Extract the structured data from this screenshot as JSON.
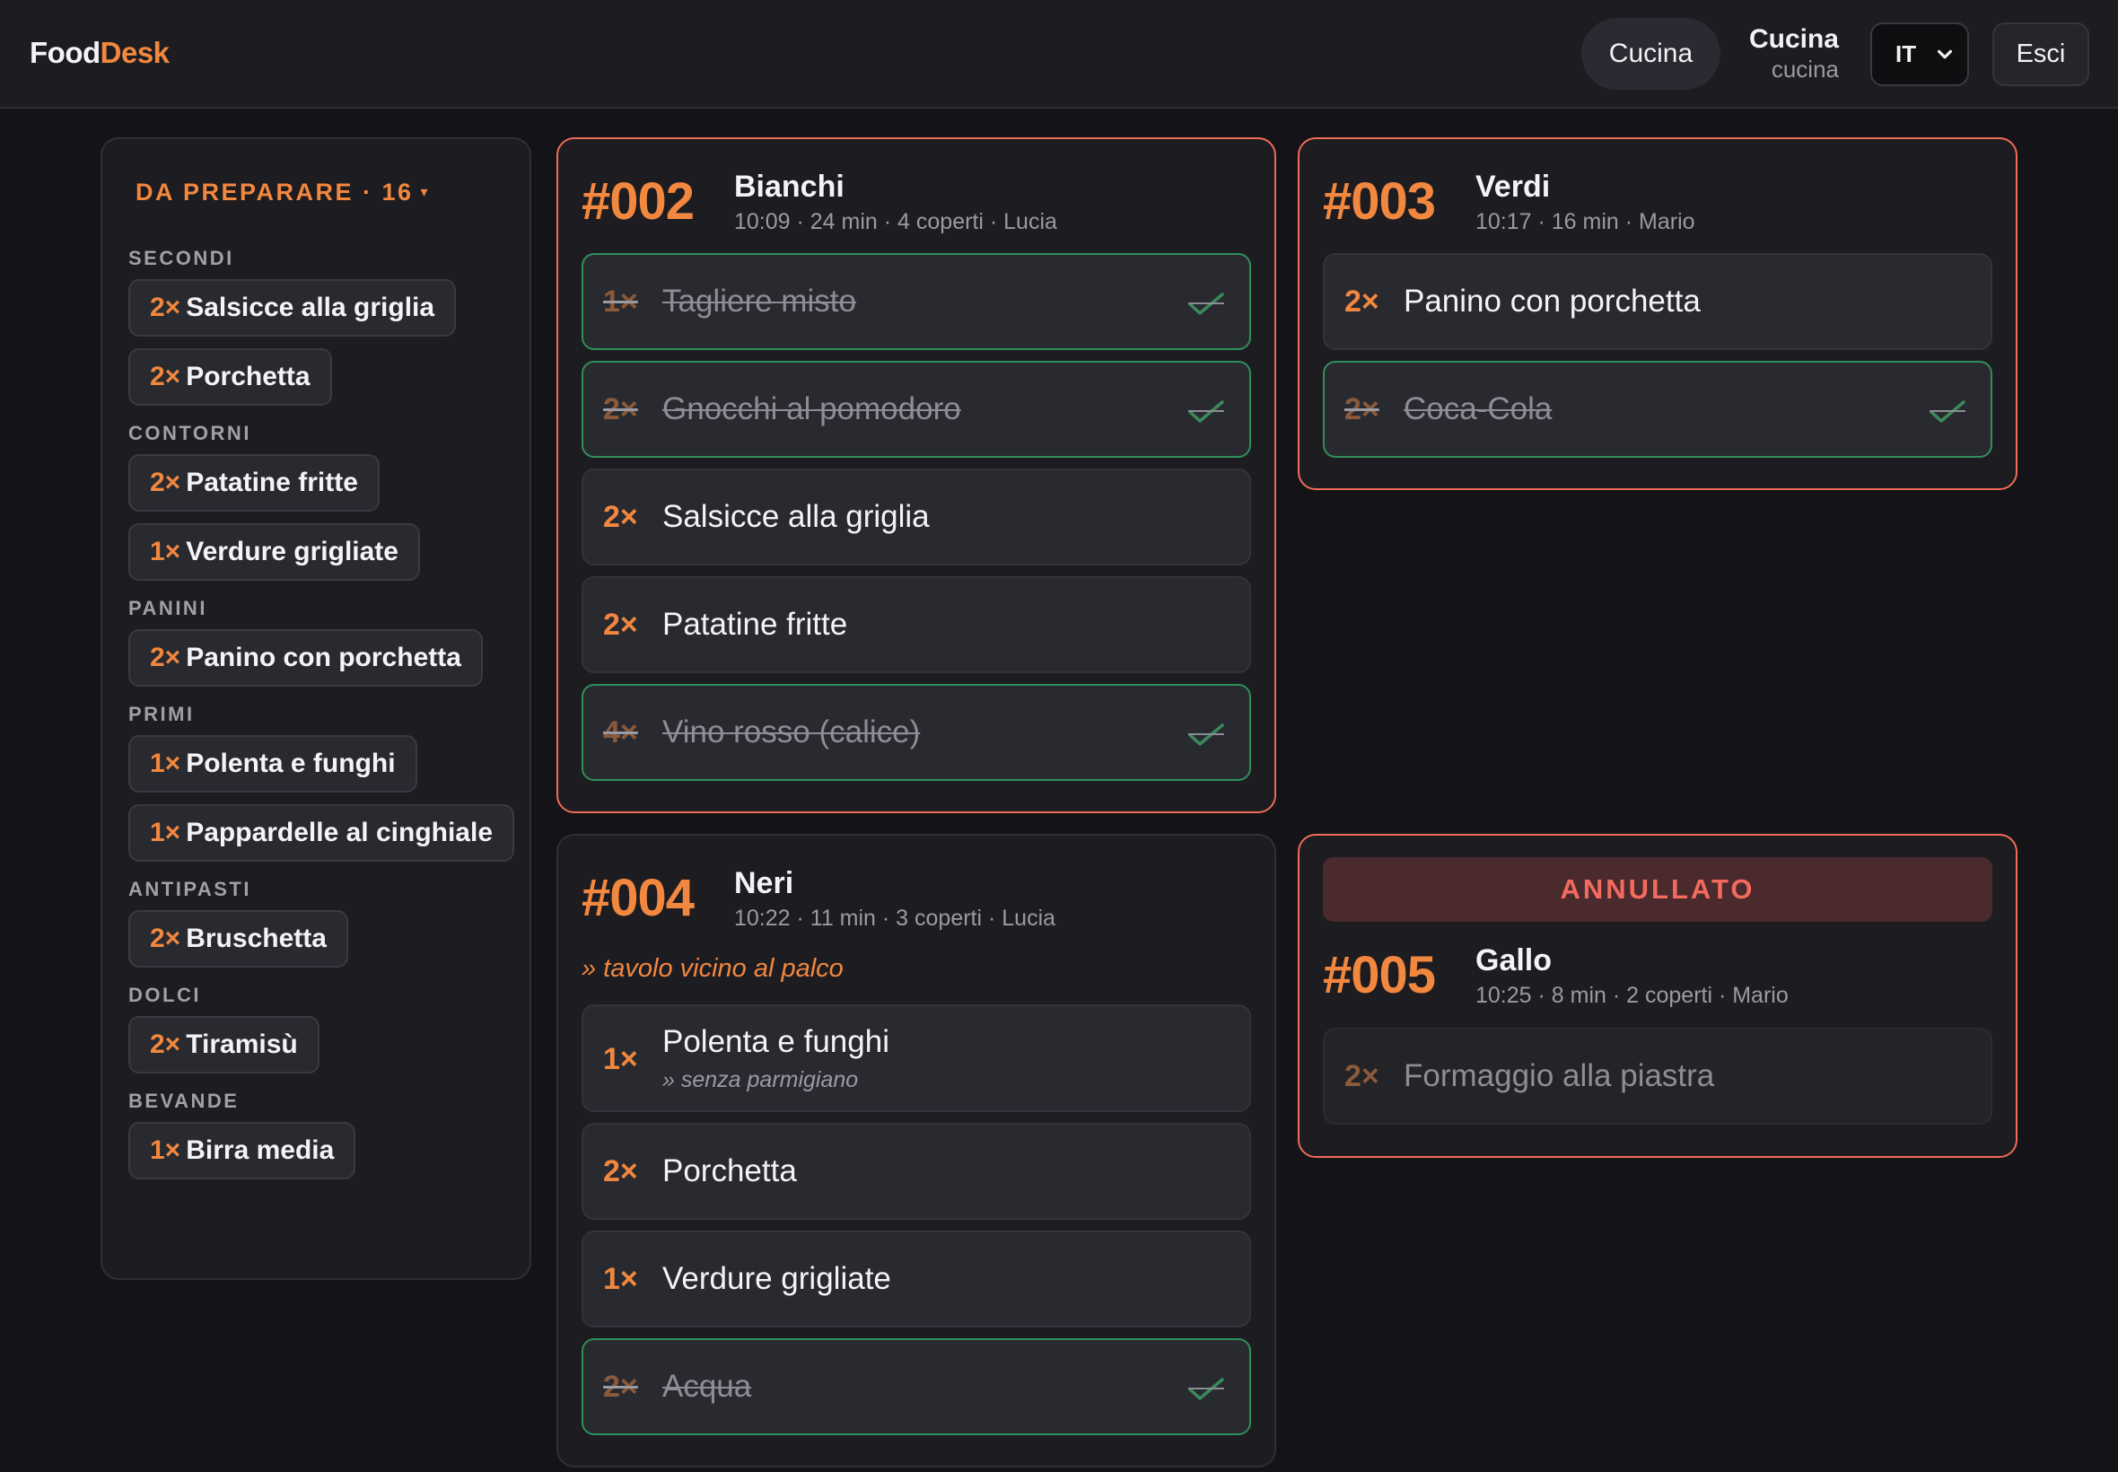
{
  "header": {
    "logo_part1": "Food",
    "logo_part2": "Desk",
    "role_button": "Cucina",
    "user_name": "Cucina",
    "user_role": "cucina",
    "language": "IT",
    "exit_button": "Esci"
  },
  "summary": {
    "title": "DA PREPARARE · 16",
    "caret": "▾",
    "categories": [
      {
        "name": "SECONDI",
        "items": [
          {
            "qty": "2×",
            "name": "Salsicce alla griglia"
          },
          {
            "qty": "2×",
            "name": "Porchetta"
          }
        ]
      },
      {
        "name": "CONTORNI",
        "items": [
          {
            "qty": "2×",
            "name": "Patatine fritte"
          },
          {
            "qty": "1×",
            "name": "Verdure grigliate"
          }
        ]
      },
      {
        "name": "PANINI",
        "items": [
          {
            "qty": "2×",
            "name": "Panino con porchetta"
          }
        ]
      },
      {
        "name": "PRIMI",
        "items": [
          {
            "qty": "1×",
            "name": "Polenta e funghi"
          },
          {
            "qty": "1×",
            "name": "Pappardelle al cinghiale"
          }
        ]
      },
      {
        "name": "ANTIPASTI",
        "items": [
          {
            "qty": "2×",
            "name": "Bruschetta"
          }
        ]
      },
      {
        "name": "DOLCI",
        "items": [
          {
            "qty": "2×",
            "name": "Tiramisù"
          }
        ]
      },
      {
        "name": "BEVANDE",
        "items": [
          {
            "qty": "1×",
            "name": "Birra media"
          }
        ]
      }
    ]
  },
  "orders": {
    "o002": {
      "number": "#002",
      "customer": "Bianchi",
      "meta": "10:09 · 24 min · 4 coperti · Lucia",
      "items": [
        {
          "qty": "1×",
          "name": "Tagliere misto"
        },
        {
          "qty": "2×",
          "name": "Gnocchi al pomodoro"
        },
        {
          "qty": "2×",
          "name": "Salsicce alla griglia"
        },
        {
          "qty": "2×",
          "name": "Patatine fritte"
        },
        {
          "qty": "4×",
          "name": "Vino rosso (calice)"
        }
      ]
    },
    "o003": {
      "number": "#003",
      "customer": "Verdi",
      "meta": "10:17 · 16 min · Mario",
      "items": [
        {
          "qty": "2×",
          "name": "Panino con porchetta"
        },
        {
          "qty": "2×",
          "name": "Coca-Cola"
        }
      ]
    },
    "o004": {
      "number": "#004",
      "customer": "Neri",
      "meta": "10:22 · 11 min · 3 coperti · Lucia",
      "note": "» tavolo vicino al palco",
      "items": [
        {
          "qty": "1×",
          "name": "Polenta e funghi",
          "note": "» senza parmigiano"
        },
        {
          "qty": "2×",
          "name": "Porchetta"
        },
        {
          "qty": "1×",
          "name": "Verdure grigliate"
        },
        {
          "qty": "2×",
          "name": "Acqua"
        }
      ]
    },
    "o005": {
      "status": "ANNULLATO",
      "number": "#005",
      "customer": "Gallo",
      "meta": "10:25 · 8 min · 2 coperti · Mario",
      "items": [
        {
          "qty": "2×",
          "name": "Formaggio alla piastra"
        }
      ]
    }
  },
  "colors": {
    "accent": "#f2873f",
    "alert_border": "#f06a58",
    "done_border": "#2f8f5a",
    "background": "#141418"
  }
}
